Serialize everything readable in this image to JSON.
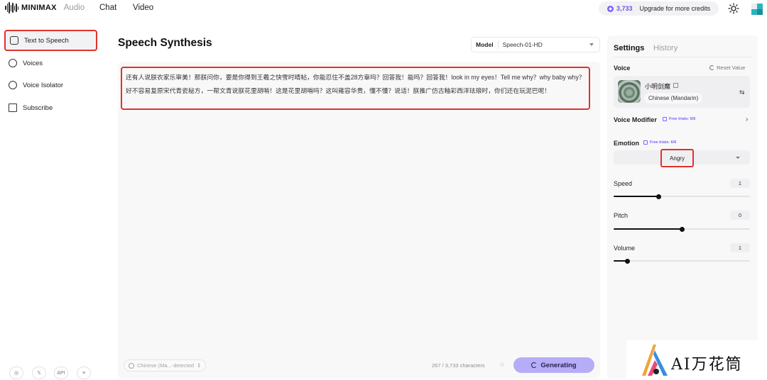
{
  "brand": {
    "logo_text": "MINIMAX",
    "product": "Audio"
  },
  "topnav": {
    "chat": "Chat",
    "video": "Video"
  },
  "credits": {
    "amount": "3,733",
    "upgrade_label": "Upgrade for more credits"
  },
  "sidebar": {
    "items": [
      {
        "label": "Text to Speech",
        "icon": "tts-icon",
        "active": true
      },
      {
        "label": "Voices",
        "icon": "voices-icon"
      },
      {
        "label": "Voice Isolator",
        "icon": "isolator-icon"
      },
      {
        "label": "Subscribe",
        "icon": "crown-icon"
      }
    ],
    "footer": {
      "api": "API"
    }
  },
  "main": {
    "title": "Speech Synthesis",
    "model_label": "Model",
    "model_value": "Speech-01-HD",
    "text": "还有人说朕农家乐审美！那朕问你，要是你得到王羲之快雪时晴帖，你能忍住不盖28方章吗？回答我！能吗？回答我！look in my eyes！Tell me why？why baby why？ 好不容易复原宋代青瓷秘方，一帮文青说朕花里胡哨！这是花里胡哨吗？这叫雍容华贵，懂不懂？说话！朕推广仿古釉彩西洋珐琅时，你们还在玩泥巴呢！",
    "language": "Chinese (Ma...-detected",
    "char_count": "267 / 3,733 characters",
    "generate_label": "Generating"
  },
  "settings": {
    "tab_settings": "Settings",
    "tab_history": "History",
    "voice_label": "Voice",
    "reset_label": "Reset Value",
    "voice_name": "小明剑魔",
    "voice_lang": "Chinese (Mandarin)",
    "voice_modifier_label": "Voice Modifier",
    "voice_modifier_trial": "Free trials: 6/6",
    "emotion_label": "Emotion",
    "emotion_trial": "Free trials: 6/6",
    "emotion_value": "Angry",
    "speed_label": "Speed",
    "speed_value": "1",
    "speed_fraction": 0.33,
    "pitch_label": "Pitch",
    "pitch_value": "0",
    "pitch_fraction": 0.5,
    "volume_label": "Volume",
    "volume_value": "1",
    "volume_fraction": 0.1
  },
  "watermark": {
    "text": "AI万花筒"
  },
  "colors": {
    "accent": "#7b61ff",
    "highlight": "#e0322d",
    "generate_bg": "#b6adf7"
  }
}
